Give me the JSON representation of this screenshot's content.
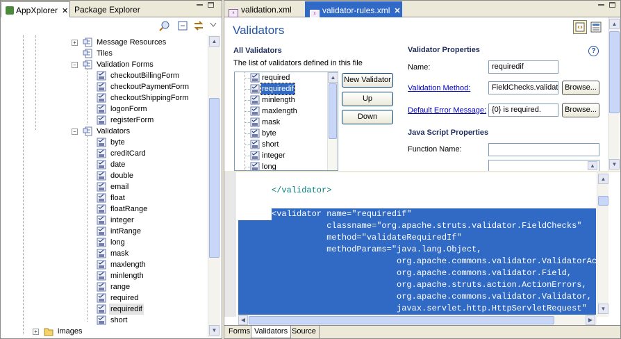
{
  "left_view": {
    "tabs": [
      {
        "label": "AppXplorer",
        "close": "✕"
      },
      {
        "label": "Package Explorer"
      }
    ],
    "tree": {
      "message_resources": "Message Resources",
      "tiles": "Tiles",
      "validation_forms": "Validation Forms",
      "forms": [
        "checkoutBillingForm",
        "checkoutPaymentForm",
        "checkoutShippingForm",
        "logonForm",
        "registerForm"
      ],
      "validators": "Validators",
      "validator_items": [
        "byte",
        "creditCard",
        "date",
        "double",
        "email",
        "float",
        "floatRange",
        "integer",
        "intRange",
        "long",
        "mask",
        "maxlength",
        "minlength",
        "range",
        "required",
        "requiredif",
        "short"
      ],
      "images": "images"
    }
  },
  "editor": {
    "tabs": [
      {
        "label": "validation.xml"
      },
      {
        "label": "validator-rules.xml",
        "close": "✕"
      }
    ],
    "title": "Validators",
    "all_validators": {
      "heading": "All Validators",
      "description": "The list of validators defined in this file",
      "items": [
        "required",
        "requiredif",
        "minlength",
        "maxlength",
        "mask",
        "byte",
        "short",
        "integer",
        "long"
      ],
      "selected": "requiredif",
      "new_button": "New Validator",
      "up_button": "Up",
      "down_button": "Down"
    },
    "properties": {
      "heading": "Validator Properties",
      "help": "?",
      "name_label": "Name:",
      "name_value": "requiredif",
      "method_label": "Validation Method:",
      "method_value": "FieldChecks.validat",
      "browse1": "Browse...",
      "error_label": "Default Error Message:",
      "error_value": "{0} is required.",
      "browse2": "Browse...",
      "js_heading": "Java Script Properties",
      "function_label": "Function Name:",
      "function_value": ""
    },
    "source": {
      "lines": [
        "</validator>",
        "",
        "<validator name=\"requiredif\"",
        "           classname=\"org.apache.struts.validator.FieldChecks\"",
        "           method=\"validateRequiredIf\"",
        "           methodParams=\"java.lang.Object,",
        "                         org.apache.commons.validator.ValidatorAction,",
        "                         org.apache.commons.validator.Field,",
        "                         org.apache.struts.action.ActionErrors,",
        "                         org.apache.commons.validator.Validator,",
        "                         javax.servlet.http.HttpServletRequest\""
      ]
    },
    "bottom_tabs": [
      "Forms",
      "Validators",
      "Source"
    ],
    "active_bottom_tab": "Validators"
  },
  "colors": {
    "selection": "#316ac5",
    "title": "#2352a0",
    "link": "#0000c0",
    "tag": "#007f7f",
    "attr": "#7f007f",
    "value": "#2a00ff"
  }
}
